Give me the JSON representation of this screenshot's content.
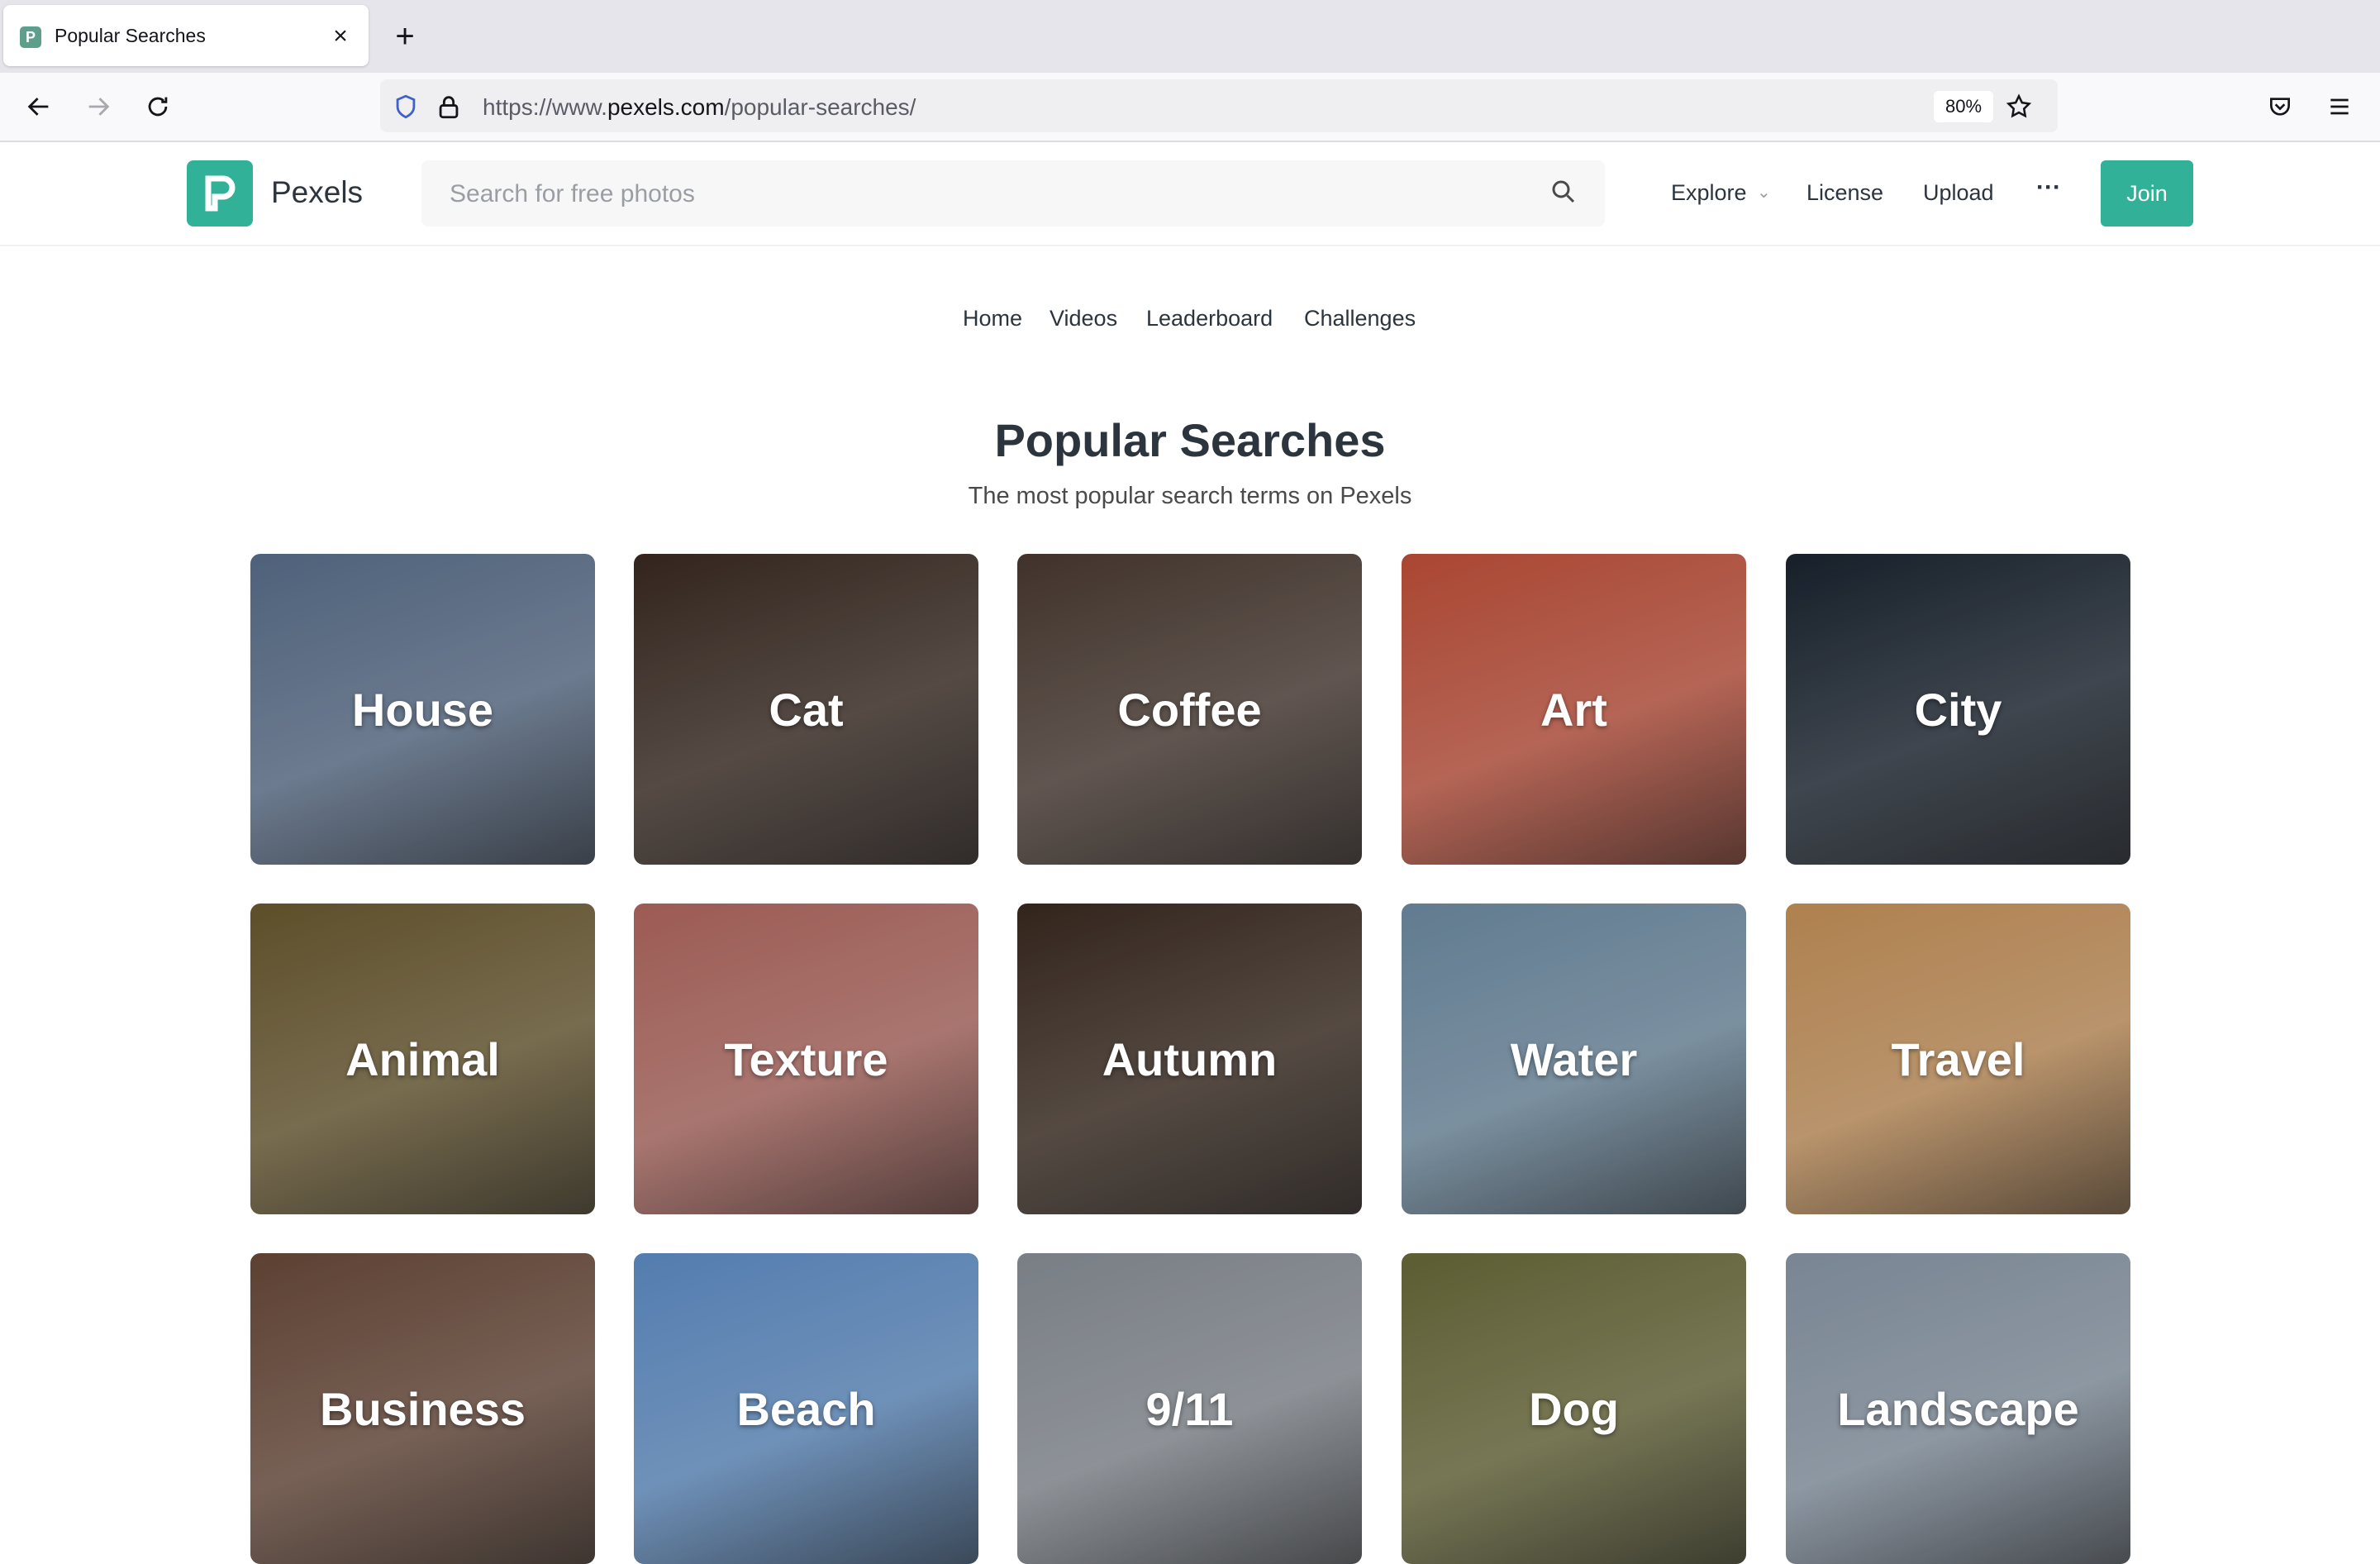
{
  "browser": {
    "tab_title": "Popular Searches",
    "url_prefix": "https://www.",
    "url_host": "pexels.com",
    "url_path": "/popular-searches/",
    "zoom": "80%"
  },
  "header": {
    "logo_text": "Pexels",
    "search_placeholder": "Search for free photos",
    "nav": {
      "explore": "Explore",
      "license": "License",
      "upload": "Upload",
      "more": "···",
      "join": "Join"
    }
  },
  "subnav": [
    "Home",
    "Videos",
    "Leaderboard",
    "Challenges"
  ],
  "page": {
    "title": "Popular Searches",
    "subtitle": "The most popular search terms on Pexels"
  },
  "cards": [
    {
      "label": "House",
      "color": "#5a6f8c"
    },
    {
      "label": "Cat",
      "color": "#3a2a22"
    },
    {
      "label": "Coffee",
      "color": "#4a3a32"
    },
    {
      "label": "Art",
      "color": "#c2503a"
    },
    {
      "label": "City",
      "color": "#1a2430"
    },
    {
      "label": "Animal",
      "color": "#6b5a30"
    },
    {
      "label": "Texture",
      "color": "#b26860"
    },
    {
      "label": "Autumn",
      "color": "#3a2a20"
    },
    {
      "label": "Water",
      "color": "#6f8da4"
    },
    {
      "label": "Travel",
      "color": "#c8935a"
    },
    {
      "label": "Business",
      "color": "#6a4a3a"
    },
    {
      "label": "Beach",
      "color": "#5f8fc8"
    },
    {
      "label": "9/11",
      "color": "#8a9098"
    },
    {
      "label": "Dog",
      "color": "#6a6a3a"
    },
    {
      "label": "Landscape",
      "color": "#8a98a8"
    }
  ],
  "colors": {
    "brand": "#05a081",
    "text": "#2c343e"
  }
}
